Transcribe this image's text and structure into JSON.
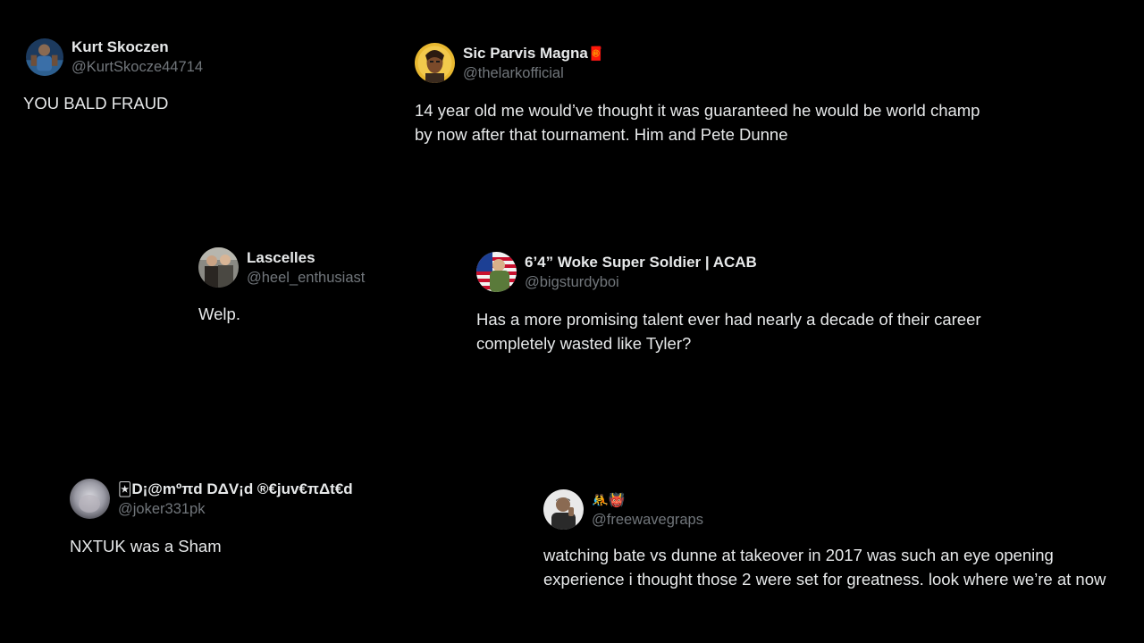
{
  "colors": {
    "background": "#000000",
    "text": "#e7e9ea",
    "handle": "#71767b"
  },
  "tweets": [
    {
      "display_name": "Kurt Skoczen",
      "handle": "@KurtSkocze44714",
      "text": "YOU BALD FRAUD",
      "avatar": "wrestler-photo-avatar"
    },
    {
      "display_name": "Sic Parvis Magna",
      "name_emoji": "🧧",
      "handle": "@thelarkofficial",
      "text": "14 year old me would’ve thought it was guaranteed he would be world champ by now after that tournament. Him and Pete Dunne",
      "avatar": "cartoon-portrait-avatar"
    },
    {
      "display_name": "Lascelles",
      "handle": "@heel_enthusiast",
      "text": "Welp.",
      "avatar": "two-people-photo-avatar"
    },
    {
      "display_name": "6’4” Woke Super Soldier | ACAB",
      "handle": "@bigsturdyboi",
      "text": "Has a more promising talent ever had nearly a decade of their career completely wasted like Tyler?",
      "avatar": "flag-hero-avatar"
    },
    {
      "name_emoji": "🃏",
      "display_name": "D¡@mºπd DΔV¡d ®€juv€πΔt€d",
      "handle": "@joker331pk",
      "text": "NXTUK was a Sham",
      "avatar": "blurred-photo-avatar"
    },
    {
      "name_emoji": "🤼👹",
      "handle": "@freewavegraps",
      "text": "watching bate vs dunne at takeover in 2017 was such an eye opening experience i thought those 2 were set for greatness. look where we’re at now",
      "avatar": "person-photo-avatar"
    }
  ]
}
